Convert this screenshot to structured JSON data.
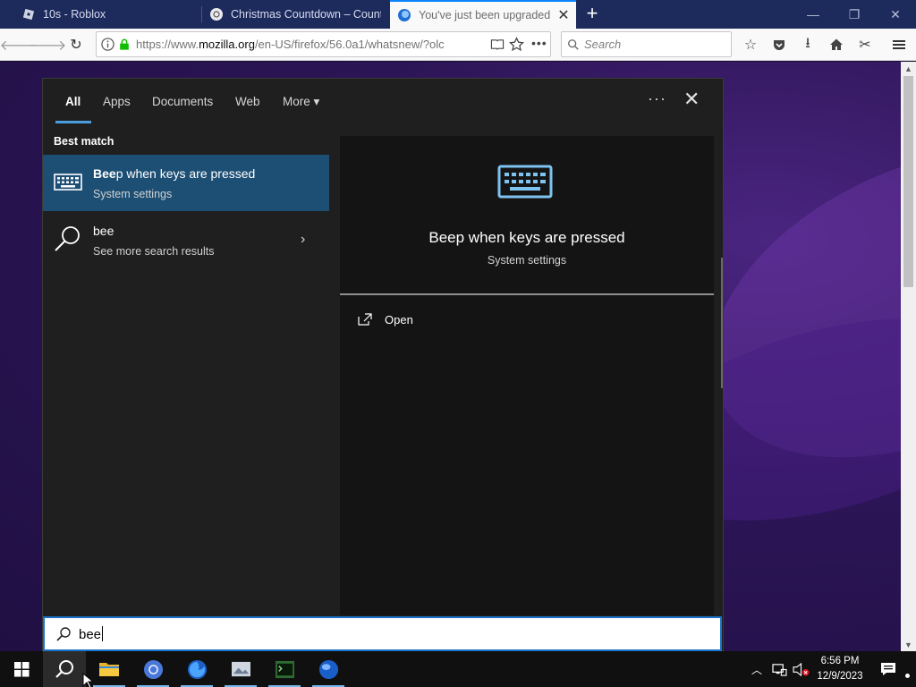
{
  "browser": {
    "tabs": [
      {
        "label": "10s - Roblox",
        "active": false
      },
      {
        "label": "Christmas Countdown – Count",
        "active": false
      },
      {
        "label": "You've just been upgraded t",
        "active": true
      }
    ],
    "url_prefix": "https://www.",
    "url_domain": "mozilla.org",
    "url_path": "/en-US/firefox/56.0a1/whatsnew/?olc",
    "search_placeholder": "Search",
    "accent": "#0a84ff"
  },
  "start_search": {
    "filters": [
      "All",
      "Apps",
      "Documents",
      "Web",
      "More"
    ],
    "more_arrow": "▾",
    "ellipsis": "···",
    "close": "✕",
    "best_match_label": "Best match",
    "results": [
      {
        "title_bold": "Bee",
        "title_rest": "p when keys are pressed",
        "subtitle": "System settings",
        "icon": "keyboard-icon",
        "selected": true
      },
      {
        "title_bold": "",
        "title_rest": "bee",
        "subtitle": "See more search results",
        "icon": "search-icon",
        "selected": false,
        "arrow": "›"
      }
    ],
    "preview": {
      "title": "Beep when keys are pressed",
      "subtitle": "System settings",
      "actions": [
        {
          "label": "Open",
          "icon": "open-external-icon"
        }
      ]
    },
    "query": "bee",
    "selection_color": "#1d4f75",
    "focus_color": "#1a73c9"
  },
  "taskbar": {
    "apps": [
      "start-icon",
      "search-icon",
      "file-explorer-icon",
      "chrome-icon",
      "firefox-icon",
      "photos-icon",
      "terminal-icon",
      "globe-icon"
    ],
    "time": "6:56 PM",
    "date": "12/9/2023"
  }
}
